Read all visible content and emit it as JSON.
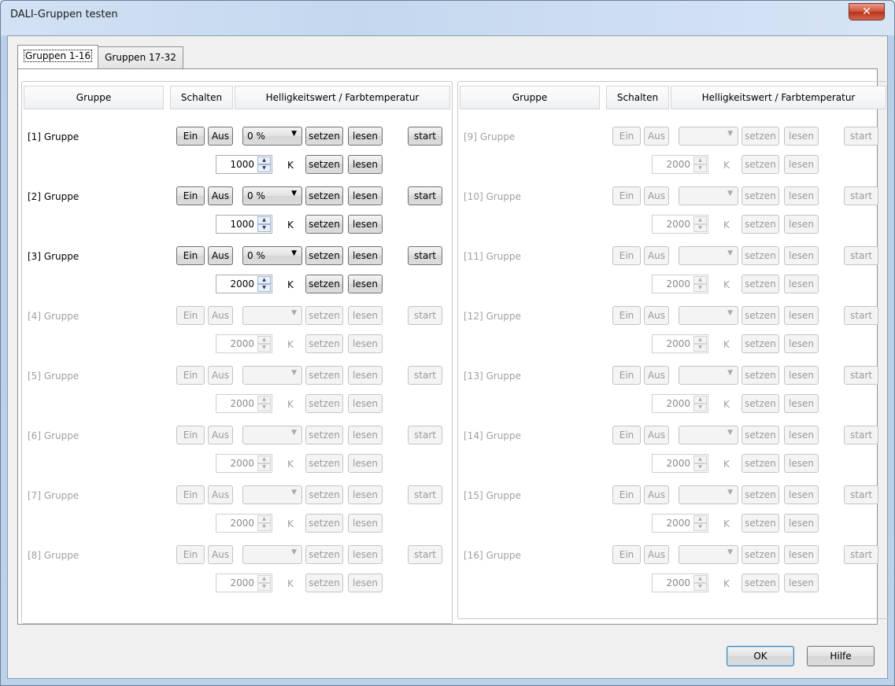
{
  "window": {
    "title": "DALI-Gruppen testen",
    "close_symbol": "✕"
  },
  "tabs": [
    {
      "label": "Gruppen 1-16",
      "active": true
    },
    {
      "label": "Gruppen 17-32",
      "active": false
    }
  ],
  "headers": {
    "group": "Gruppe",
    "switch": "Schalten",
    "brightness": "Helligkeitswert / Farbtemperatur"
  },
  "labels": {
    "on": "Ein",
    "off": "Aus",
    "set": "setzen",
    "read": "lesen",
    "start": "start",
    "unit_kelvin": "K"
  },
  "groups_left": [
    {
      "label": "[1] Gruppe",
      "enabled": true,
      "brightness": "0 %",
      "color_temp": "1000"
    },
    {
      "label": "[2] Gruppe",
      "enabled": true,
      "brightness": "0 %",
      "color_temp": "1000"
    },
    {
      "label": "[3] Gruppe",
      "enabled": true,
      "brightness": "0 %",
      "color_temp": "2000"
    },
    {
      "label": "[4] Gruppe",
      "enabled": false,
      "brightness": "",
      "color_temp": "2000"
    },
    {
      "label": "[5] Gruppe",
      "enabled": false,
      "brightness": "",
      "color_temp": "2000"
    },
    {
      "label": "[6] Gruppe",
      "enabled": false,
      "brightness": "",
      "color_temp": "2000"
    },
    {
      "label": "[7] Gruppe",
      "enabled": false,
      "brightness": "",
      "color_temp": "2000"
    },
    {
      "label": "[8] Gruppe",
      "enabled": false,
      "brightness": "",
      "color_temp": "2000"
    }
  ],
  "groups_right": [
    {
      "label": "[9] Gruppe",
      "enabled": false,
      "brightness": "",
      "color_temp": "2000"
    },
    {
      "label": "[10] Gruppe",
      "enabled": false,
      "brightness": "",
      "color_temp": "2000"
    },
    {
      "label": "[11] Gruppe",
      "enabled": false,
      "brightness": "",
      "color_temp": "2000"
    },
    {
      "label": "[12] Gruppe",
      "enabled": false,
      "brightness": "",
      "color_temp": "2000"
    },
    {
      "label": "[13] Gruppe",
      "enabled": false,
      "brightness": "",
      "color_temp": "2000"
    },
    {
      "label": "[14] Gruppe",
      "enabled": false,
      "brightness": "",
      "color_temp": "2000"
    },
    {
      "label": "[15] Gruppe",
      "enabled": false,
      "brightness": "",
      "color_temp": "2000"
    },
    {
      "label": "[16] Gruppe",
      "enabled": false,
      "brightness": "",
      "color_temp": "2000"
    }
  ],
  "footer": {
    "ok": "OK",
    "help": "Hilfe"
  },
  "icons": {
    "dropdown": "chevron-down-icon",
    "spinner": "spinner-arrows-icon",
    "close": "close-icon"
  }
}
